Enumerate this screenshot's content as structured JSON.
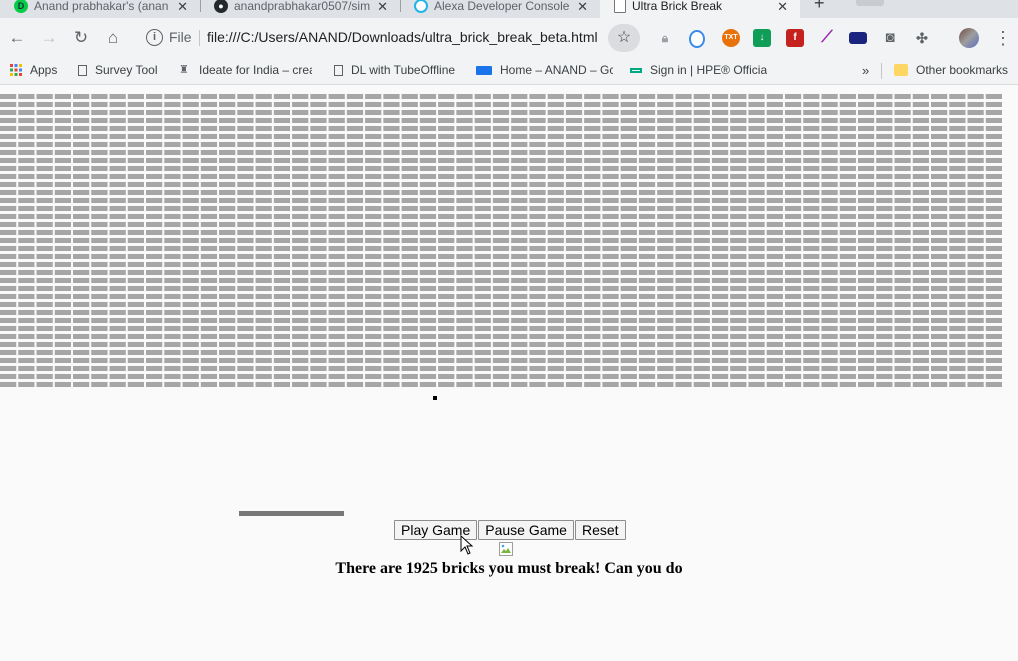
{
  "browser": {
    "tabs": [
      {
        "title": "Anand prabhakar's (anan",
        "icon": "deviantart-icon",
        "active": false
      },
      {
        "title": "anandprabhakar0507/sim",
        "icon": "github-icon",
        "active": false
      },
      {
        "title": "Alexa Developer Console",
        "icon": "alexa-icon",
        "active": false
      },
      {
        "title": "Ultra Brick Break",
        "icon": "page-icon",
        "active": true
      }
    ],
    "new_tab": "+",
    "address": {
      "scheme": "File",
      "url": "file:///C:/Users/ANAND/Downloads/ultra_brick_break_beta.html"
    },
    "extensions": [
      "lock-icon",
      "shield-icon",
      "txt-icon",
      "download-icon",
      "flash-icon",
      "feather-icon",
      "books-icon",
      "camera-icon",
      "puzzle-icon"
    ],
    "bookmarks": [
      {
        "label": "Apps",
        "icon": "apps-grid-icon"
      },
      {
        "label": "Survey Tool",
        "icon": "page-icon"
      },
      {
        "label": "Ideate for India – crea",
        "icon": "emblem-icon"
      },
      {
        "label": "DL with TubeOffline",
        "icon": "page-icon"
      },
      {
        "label": "Home – ANAND – Gc",
        "icon": "card-icon"
      },
      {
        "label": "Sign in | HPE® Officia",
        "icon": "hpe-icon"
      }
    ],
    "bookmarks_more": "»",
    "other_bookmarks": "Other bookmarks"
  },
  "game": {
    "title": "Ultra Brick Break",
    "brick_grid": {
      "rows": 37,
      "columns": 55,
      "brick_color": "#a6a6a6"
    },
    "buttons": {
      "play": "Play Game",
      "pause": "Pause Game",
      "reset": "Reset"
    },
    "message": "There are 1925 bricks you must break! Can you do",
    "colors": {
      "paddle": "#777777",
      "ball": "#000000",
      "background": "#fafafa"
    }
  }
}
